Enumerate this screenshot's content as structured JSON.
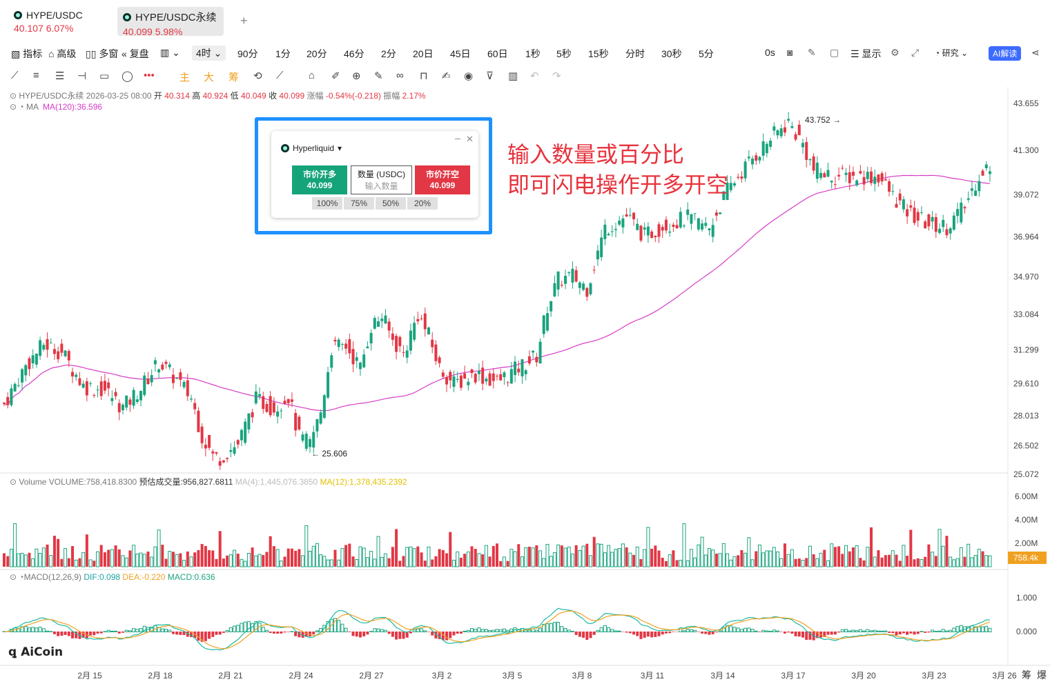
{
  "tabs": [
    {
      "name": "HYPE/USDC",
      "price": "40.107",
      "change": "6.07%"
    },
    {
      "name": "HYPE/USDC永续",
      "price": "40.099",
      "change": "5.98%"
    }
  ],
  "toolbar": {
    "indicators": "指标",
    "advanced": "高级",
    "multi": "多窗",
    "replay": "复盘",
    "timeframes": [
      "4时",
      "90分",
      "1分",
      "20分",
      "46分",
      "2分",
      "20日",
      "45日",
      "60日",
      "1秒",
      "5秒",
      "15秒",
      "分时",
      "30秒",
      "5分"
    ],
    "selected_timeframe": "4时",
    "countdown": "0s",
    "display": "显示",
    "research": "研究",
    "ai": "AI解读"
  },
  "drawing_bar": {
    "main": "主",
    "big": "大",
    "chip": "筹"
  },
  "ohlc": {
    "symbol": "HYPE/USDC永续",
    "date": "2026-03-25 08:00",
    "open_label": "开",
    "open": "40.314",
    "high_label": "高",
    "high": "40.924",
    "low_label": "低",
    "low": "40.049",
    "close_label": "收",
    "close": "40.099",
    "chg_label": "涨幅",
    "chg": "-0.54%(-0.218)",
    "amp_label": "振幅",
    "amp": "2.17%"
  },
  "ma": {
    "label": "MA",
    "value": "MA(120):36.596"
  },
  "volume": {
    "label": "Volume",
    "value": "VOLUME:758,418.8300",
    "est": "预估成交量:956,827.6811",
    "ma4": "MA(4):1,445,076.3850",
    "ma12": "MA(12):1,378,435.2392",
    "last": "758.4k",
    "axis": [
      "6.00M",
      "4.00M",
      "2.00M"
    ]
  },
  "macd": {
    "label": "MACD(12,26,9)",
    "dif": "DIF:0.098",
    "dea": "DEA:-0.220",
    "macd": "MACD:0.636",
    "axis": [
      "1.000",
      "0.000"
    ]
  },
  "price_axis": [
    "43.655",
    "41.300",
    "39.072",
    "36.964",
    "34.970",
    "33.084",
    "31.299",
    "29.610",
    "28.013",
    "26.502",
    "25.072"
  ],
  "marks": {
    "high": "43.752",
    "low": "25.606"
  },
  "date_axis": [
    "2月 15",
    "2月 18",
    "2月 21",
    "2月 24",
    "2月 27",
    "3月 2",
    "3月 5",
    "3月 8",
    "3月 11",
    "3月 14",
    "3月 17",
    "3月 20",
    "3月 23",
    "3月 26"
  ],
  "corner": [
    "筹",
    "爆"
  ],
  "order_panel": {
    "exchange": "Hyperliquid",
    "long_label": "市价开多",
    "long_price": "40.099",
    "qty_label": "数量 (USDC)",
    "qty_placeholder": "输入数量",
    "short_label": "市价开空",
    "short_price": "40.099",
    "pcts": [
      "100%",
      "75%",
      "50%",
      "20%"
    ]
  },
  "annotation": [
    "输入数量或百分比",
    "即可闪电操作开多开空"
  ],
  "logo": "AiCoin",
  "chart_data": {
    "type": "candlestick",
    "symbol": "HYPE/USDC永续",
    "interval": "4时",
    "ylim": [
      25.0,
      44.0
    ],
    "high": 43.752,
    "low": 25.606,
    "last": 40.099,
    "ma120_last": 36.596,
    "colors": {
      "up": "#1aa37e",
      "down": "#e23744",
      "ma": "#d63ac6"
    }
  }
}
